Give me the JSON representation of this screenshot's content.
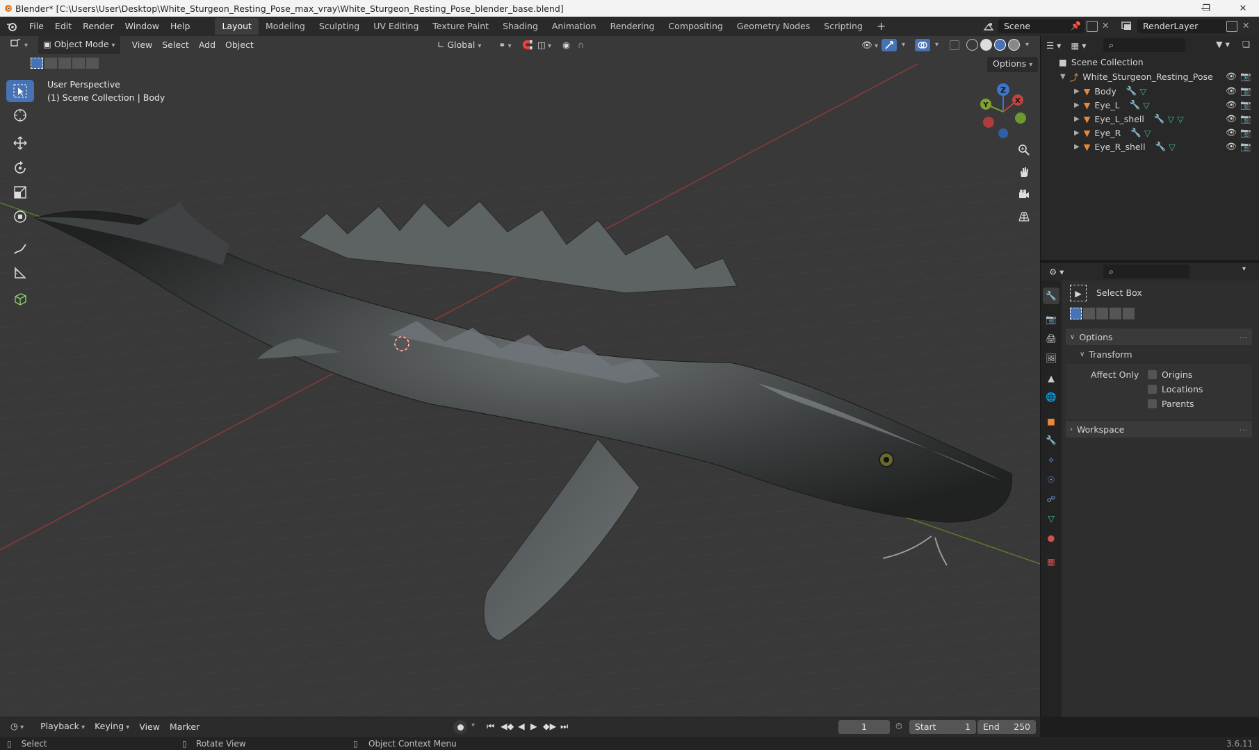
{
  "window": {
    "title": "Blender* [C:\\Users\\User\\Desktop\\White_Sturgeon_Resting_Pose_max_vray\\White_Sturgeon_Resting_Pose_blender_base.blend]"
  },
  "topbar": {
    "menus": [
      "File",
      "Edit",
      "Render",
      "Window",
      "Help"
    ],
    "workspaces": [
      "Layout",
      "Modeling",
      "Sculpting",
      "UV Editing",
      "Texture Paint",
      "Shading",
      "Animation",
      "Rendering",
      "Compositing",
      "Geometry Nodes",
      "Scripting"
    ],
    "active_workspace": "Layout",
    "scene": "Scene",
    "render_layer": "RenderLayer"
  },
  "viewport": {
    "mode": "Object Mode",
    "menus": [
      "View",
      "Select",
      "Add",
      "Object"
    ],
    "orientation": "Global",
    "options_label": "Options",
    "info_line1": "User Perspective",
    "info_line2": "(1) Scene Collection | Body",
    "gizmo": {
      "x": "X",
      "y": "Y",
      "z": "Z"
    }
  },
  "outliner": {
    "root": "Scene Collection",
    "collection": "White_Sturgeon_Resting_Pose",
    "objects": [
      "Body",
      "Eye_L",
      "Eye_L_shell",
      "Eye_R",
      "Eye_R_shell"
    ]
  },
  "properties": {
    "tool_name": "Select Box",
    "options_panel": "Options",
    "transform_panel": "Transform",
    "affect_only": "Affect Only",
    "checkboxes": [
      "Origins",
      "Locations",
      "Parents"
    ],
    "workspace_panel": "Workspace"
  },
  "timeline": {
    "menus": [
      "Playback",
      "Keying",
      "View",
      "Marker"
    ],
    "current_frame": "1",
    "start_label": "Start",
    "start": "1",
    "end_label": "End",
    "end": "250"
  },
  "statusbar": {
    "select": "Select",
    "rotate": "Rotate View",
    "context": "Object Context Menu",
    "version": "3.6.11"
  }
}
